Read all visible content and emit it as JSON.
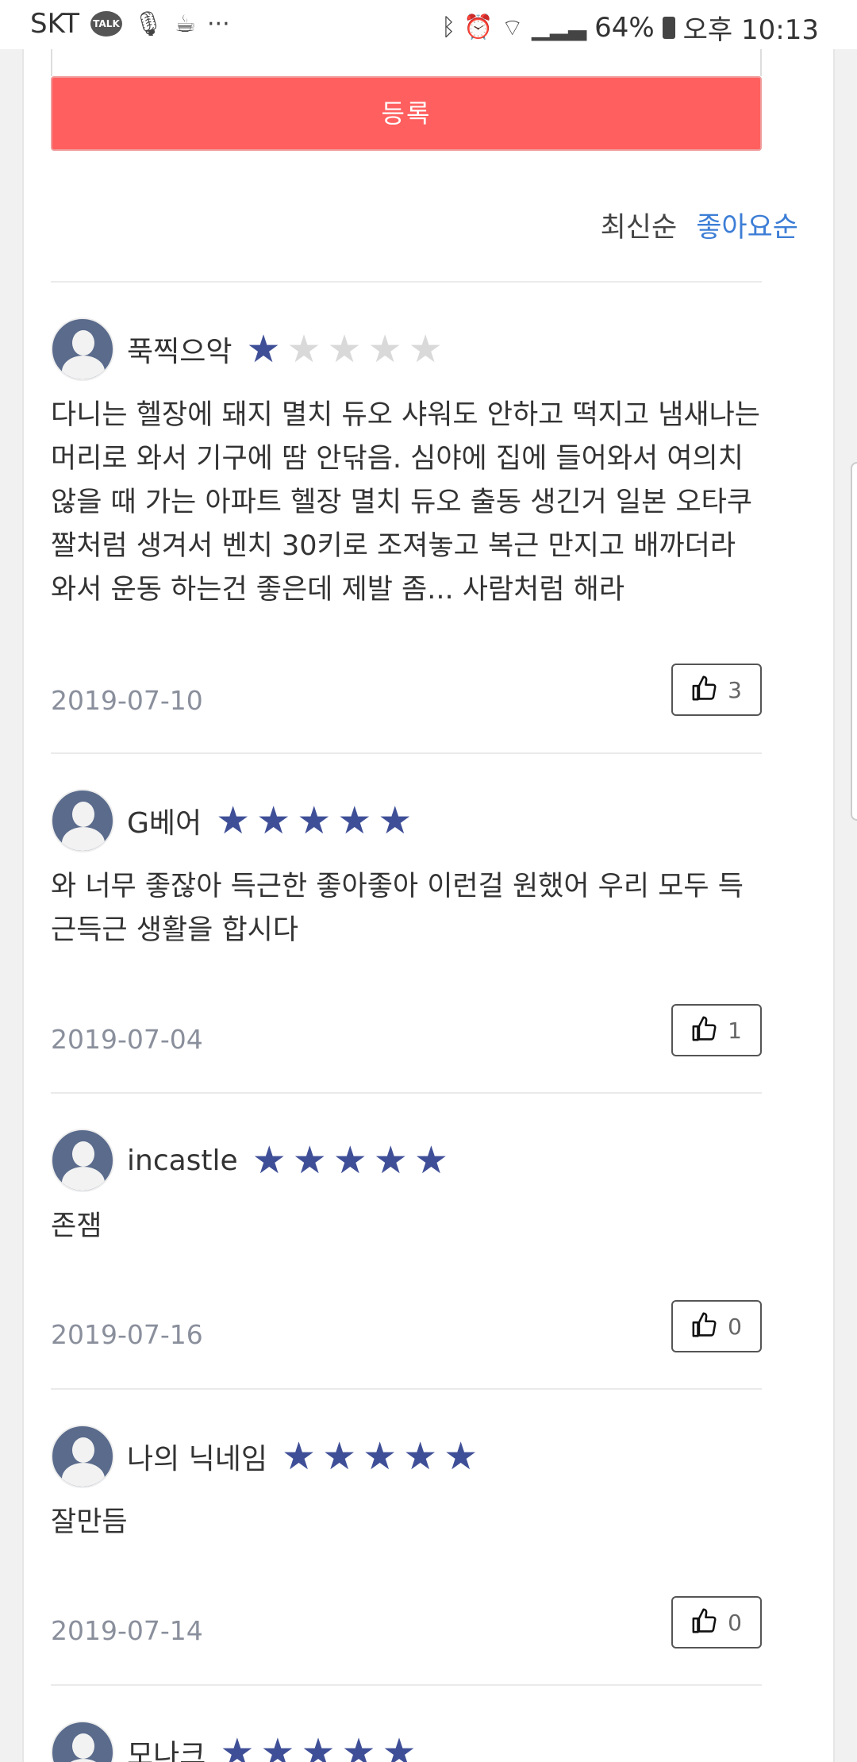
{
  "status_bar": {
    "carrier": "SKT",
    "talk_badge": "TALK",
    "more": "···",
    "battery": "64%",
    "time": "오후 10:13"
  },
  "form": {
    "submit_label": "등록"
  },
  "sort": {
    "latest": "최신순",
    "popular": "좋아요순"
  },
  "reviews": [
    {
      "nickname": "푹찍으악",
      "rating": 1,
      "text": "다니는 헬장에 돼지 멸치 듀오 샤워도 안하고 떡지고 냄새나는 머리로 와서 기구에 땀 안닦음. 심야에 집에 들어와서 여의치 않을 때 가는 아파트 헬장 멸치 듀오 출동 생긴거 일본 오타쿠 짤처럼 생겨서 벤치 30키로 조져놓고 복근 만지고 배까더라 와서 운동 하는건 좋은데 제발 좀... 사람처럼 해라",
      "date": "2019-07-10",
      "likes": "3"
    },
    {
      "nickname": "G베어",
      "rating": 5,
      "text": "와 너무 좋잖아 득근한 좋아좋아 이런걸 원했어 우리 모두 득근득근 생활을 합시다",
      "date": "2019-07-04",
      "likes": "1"
    },
    {
      "nickname": "incastle",
      "rating": 5,
      "text": "존잼",
      "date": "2019-07-16",
      "likes": "0"
    },
    {
      "nickname": "나의 닉네임",
      "rating": 5,
      "text": "잘만듬",
      "date": "2019-07-14",
      "likes": "0"
    },
    {
      "nickname": "모나크",
      "rating": 5,
      "text": "",
      "date": "",
      "likes": ""
    }
  ],
  "colors": {
    "submit": "#ff5f5f",
    "star_active": "#3f4f97",
    "star_inactive": "#d9d9d9",
    "sort_active": "#3d7ed6"
  }
}
